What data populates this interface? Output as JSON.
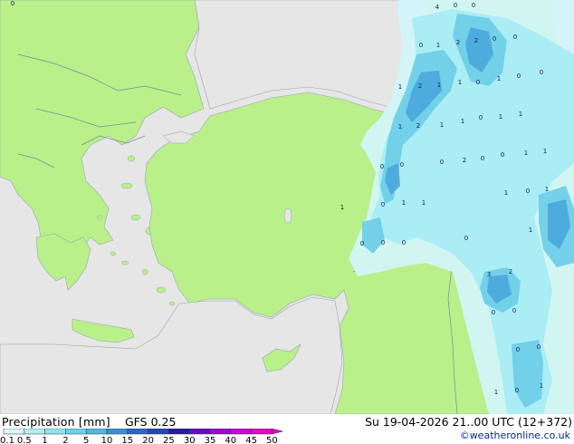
{
  "footer": {
    "title": "Precipitation [mm]",
    "model": "GFS 0.25",
    "datetime": "Su 19-04-2026 21..00 UTC (12+372)",
    "credit": "©weatheronline.co.uk"
  },
  "legend": {
    "labels": [
      "0.1",
      "0.5",
      "1",
      "2",
      "5",
      "10",
      "15",
      "20",
      "25",
      "30",
      "35",
      "40",
      "45",
      "50"
    ],
    "colors": [
      "#d9f8fa",
      "#b4eef6",
      "#8fe3f0",
      "#6fd1ea",
      "#54b6e2",
      "#3d8fd2",
      "#2d66c4",
      "#2447b0",
      "#221e9a",
      "#6a0ac8",
      "#9e0ad2",
      "#c80ad0",
      "#e60ac2"
    ]
  },
  "colors": {
    "land": "#b9f08a",
    "sea": "#e6e6e6",
    "border": "#7c8a9a",
    "rain_light": "#d2f6f8",
    "rain_mid": "#a8ecf4",
    "rain_heavy": "#6fcfe8",
    "rain_core": "#4aa6dc"
  },
  "map_labels": [
    {
      "text": "0"
    },
    {
      "text": "4"
    },
    {
      "text": "0"
    },
    {
      "text": "0"
    },
    {
      "text": "0"
    },
    {
      "text": "0"
    },
    {
      "text": "1"
    },
    {
      "text": "2"
    },
    {
      "text": "2"
    },
    {
      "text": "0"
    },
    {
      "text": "0"
    },
    {
      "text": "1"
    },
    {
      "text": "2"
    },
    {
      "text": "1"
    },
    {
      "text": "1"
    },
    {
      "text": "0"
    },
    {
      "text": "1"
    },
    {
      "text": "0"
    },
    {
      "text": "1"
    },
    {
      "text": "2"
    },
    {
      "text": "1"
    },
    {
      "text": "1"
    },
    {
      "text": "0"
    },
    {
      "text": "1"
    },
    {
      "text": "1"
    },
    {
      "text": "0"
    },
    {
      "text": "0"
    },
    {
      "text": "0"
    },
    {
      "text": "2"
    },
    {
      "text": "0"
    },
    {
      "text": "0"
    },
    {
      "text": "1"
    },
    {
      "text": "1"
    },
    {
      "text": "1"
    },
    {
      "text": "0"
    },
    {
      "text": "1"
    },
    {
      "text": "1"
    },
    {
      "text": "1"
    },
    {
      "text": "0"
    },
    {
      "text": "1"
    },
    {
      "text": "0"
    },
    {
      "text": "0"
    },
    {
      "text": "0"
    },
    {
      "text": "0"
    },
    {
      "text": "1"
    },
    {
      "text": "3"
    },
    {
      "text": "2"
    },
    {
      "text": "0"
    },
    {
      "text": "0"
    },
    {
      "text": "0"
    },
    {
      "text": "0"
    },
    {
      "text": "1"
    },
    {
      "text": "0"
    },
    {
      "text": "1"
    }
  ]
}
